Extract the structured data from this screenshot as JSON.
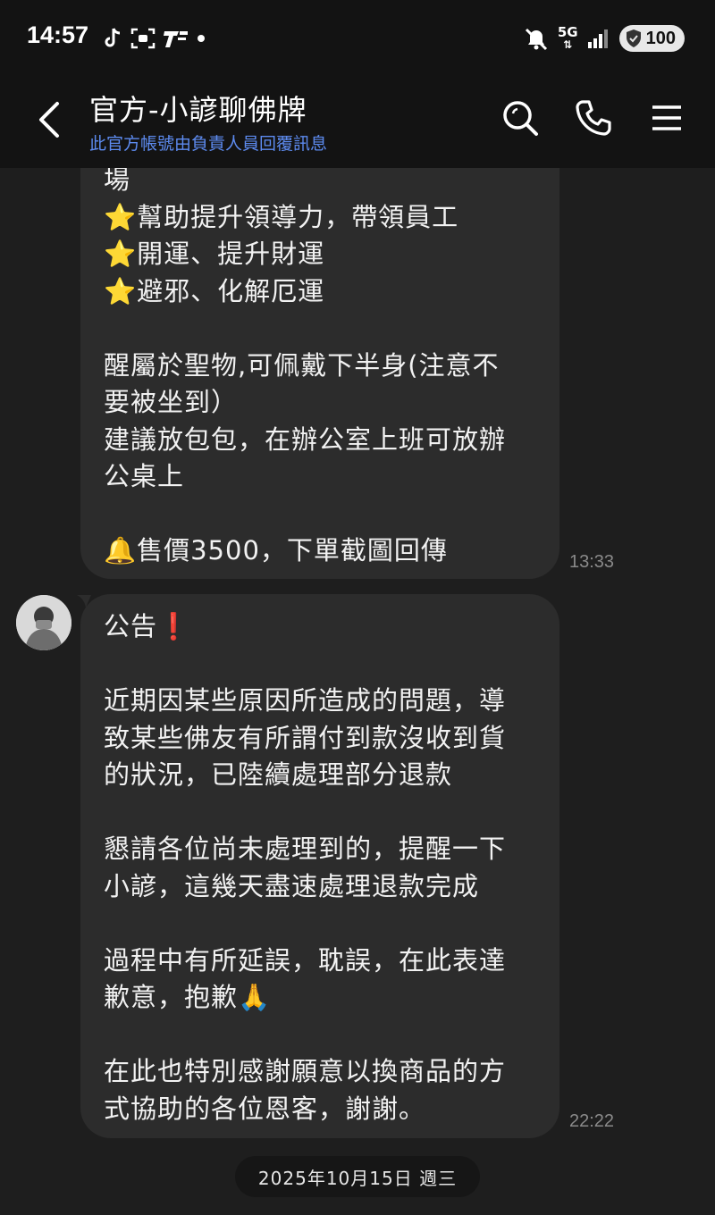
{
  "status_bar": {
    "time": "14:57",
    "network": "5G",
    "battery": "100"
  },
  "header": {
    "title": "官方-小諺聊佛牌",
    "subtitle": "此官方帳號由負責人員回覆訊息"
  },
  "messages": [
    {
      "lines": [
        "場",
        "⭐幫助提升領導力，帶領員工",
        "⭐開運、提升財運",
        "⭐避邪、化解厄運",
        "",
        "醒屬於聖物,可佩戴下半身(注意不",
        "要被坐到）",
        "建議放包包，在辦公室上班可放辦",
        "公桌上",
        "",
        "🔔售價3500，下單截圖回傳"
      ],
      "time": "13:33"
    },
    {
      "lines": [
        "公告❗",
        "",
        "近期因某些原因所造成的問題，導",
        "致某些佛友有所謂付到款沒收到貨",
        "的狀況，已陸續處理部分退款",
        "",
        "懇請各位尚未處理到的，提醒一下",
        "小諺，這幾天盡速處理退款完成",
        "",
        "過程中有所延誤，耽誤，在此表達",
        "歉意，抱歉🙏",
        "",
        "在此也特別感謝願意以換商品的方",
        "式協助的各位恩客，謝謝。"
      ],
      "time": "22:22"
    }
  ],
  "date_separator": "2025年10月15日 週三",
  "colors": {
    "background": "#1e1e1e",
    "header_bg": "#131313",
    "bubble_bg": "#2c2c2c",
    "subtitle": "#5d8bf0",
    "timestamp": "#8a8a8a"
  }
}
